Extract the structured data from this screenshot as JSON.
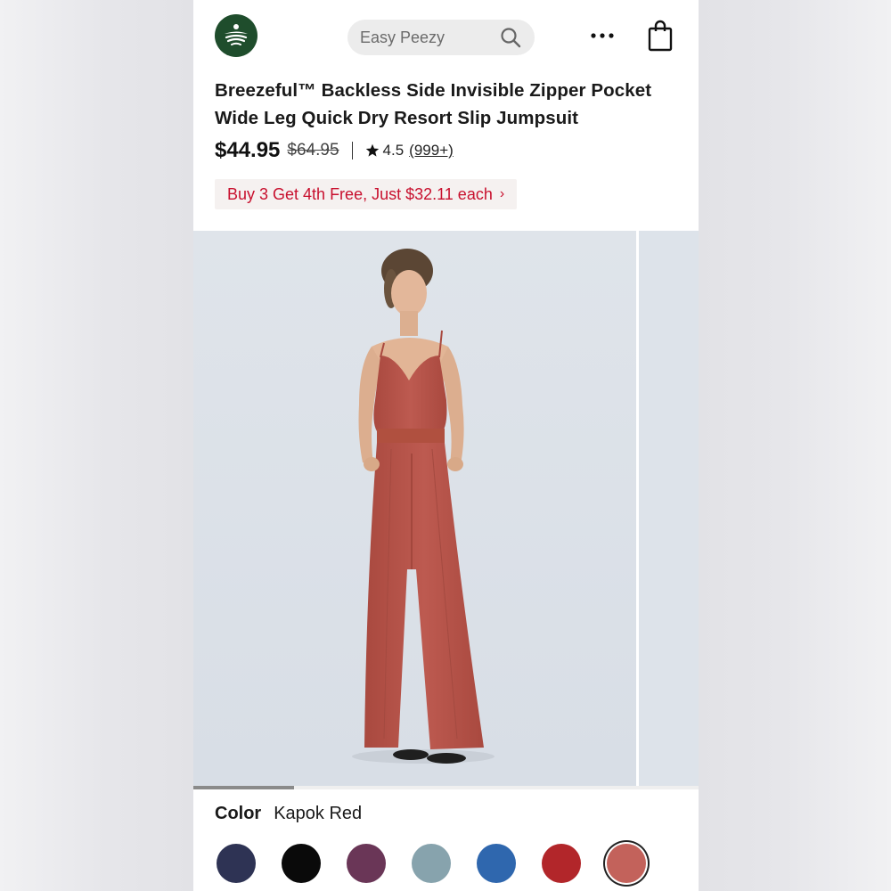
{
  "header": {
    "search_text": "Easy Peezy"
  },
  "product": {
    "title": "Breezeful™ Backless Side Invisible Zipper Pocket Wide Leg Quick Dry Resort Slip Jumpsuit",
    "price": "$44.95",
    "original_price": "$64.95",
    "rating": "4.5",
    "reviews": "(999+)",
    "promo": "Buy 3 Get 4th Free, Just $32.11 each",
    "promo_chevron": "›"
  },
  "gallery": {
    "progress": 0.2
  },
  "color": {
    "label": "Color",
    "selected": "Kapok Red",
    "swatches": [
      "#2e3354",
      "#0a0a0a",
      "#6a3657",
      "#87a3ad",
      "#2f67ae",
      "#b2262a",
      "#c3625b"
    ],
    "selected_index": 6
  },
  "colors": {
    "logo_bg": "#1f4d2c",
    "promo_text": "#c8102e",
    "jumpsuit": "#b8554c",
    "photo_bg": "#dde3ea"
  }
}
